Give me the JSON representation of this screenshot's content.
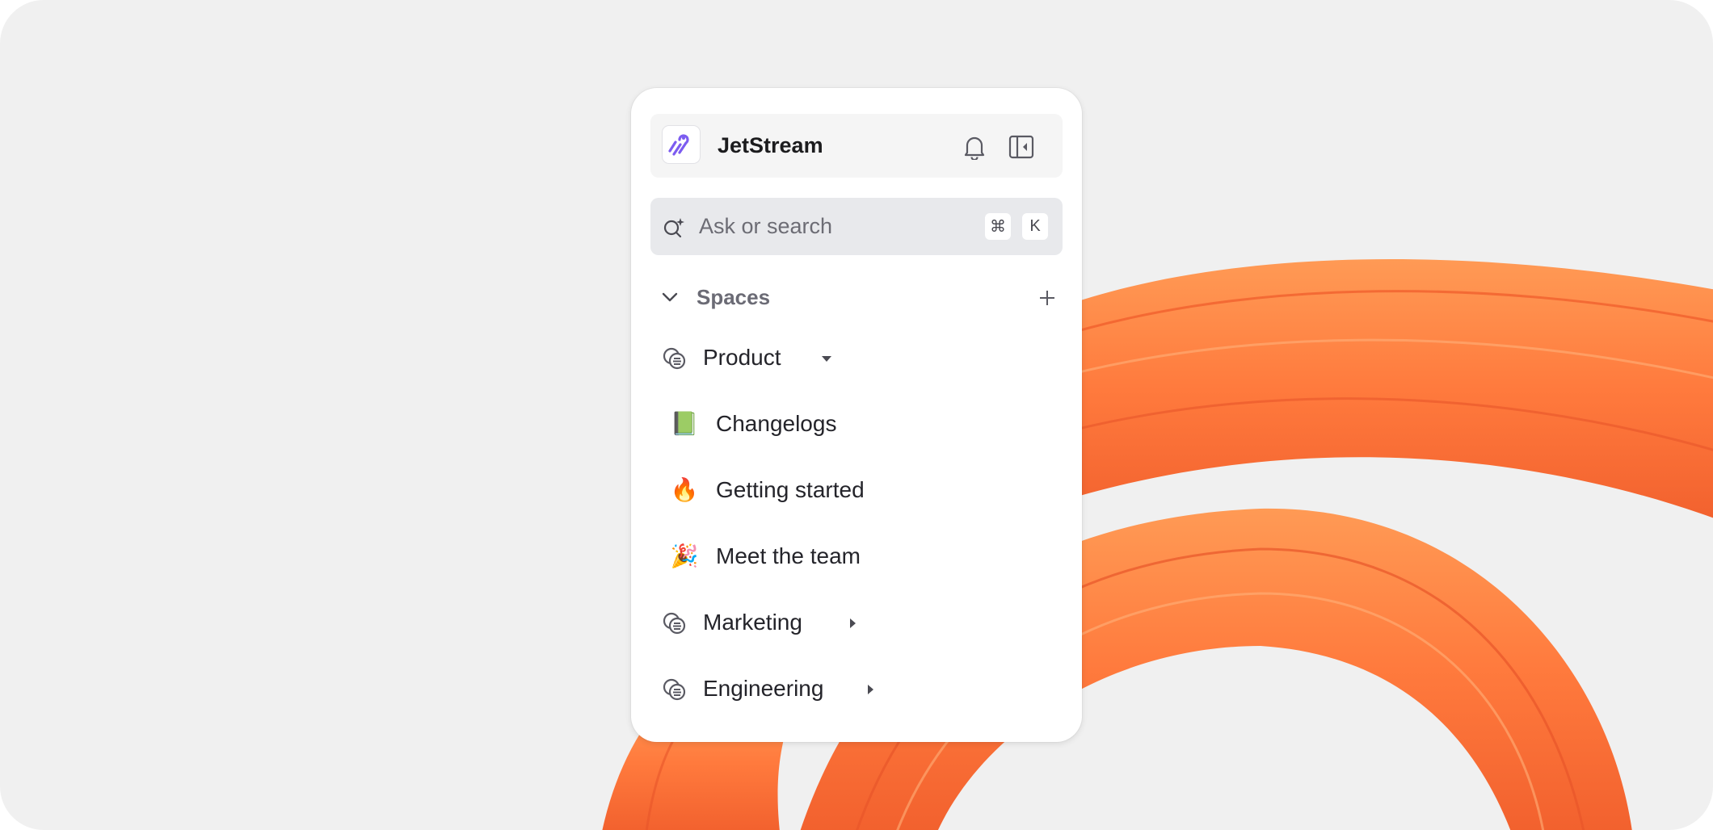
{
  "header": {
    "app_name": "JetStream",
    "logo_icon": "jetstream-logo-icon",
    "bell_icon": "bell-icon",
    "collapse_icon": "sidebar-collapse-icon"
  },
  "search": {
    "placeholder": "Ask or search",
    "shortcut_modifier": "⌘",
    "shortcut_key": "K"
  },
  "spaces": {
    "label": "Spaces",
    "items": [
      {
        "label": "Product",
        "expanded": true,
        "icon": "space-icon"
      },
      {
        "label": "Changelogs",
        "icon": "green-book-emoji",
        "emoji": "📗"
      },
      {
        "label": "Getting started",
        "icon": "fire-emoji",
        "emoji": "🔥"
      },
      {
        "label": "Meet the team",
        "icon": "party-popper-emoji",
        "emoji": "🎉"
      },
      {
        "label": "Marketing",
        "expanded": false,
        "icon": "space-icon"
      },
      {
        "label": "Engineering",
        "expanded": false,
        "icon": "space-icon"
      }
    ]
  },
  "colors": {
    "accent": "#7c5cf0",
    "background": "#f0f0f0",
    "decoration": "#ff7a3d"
  }
}
